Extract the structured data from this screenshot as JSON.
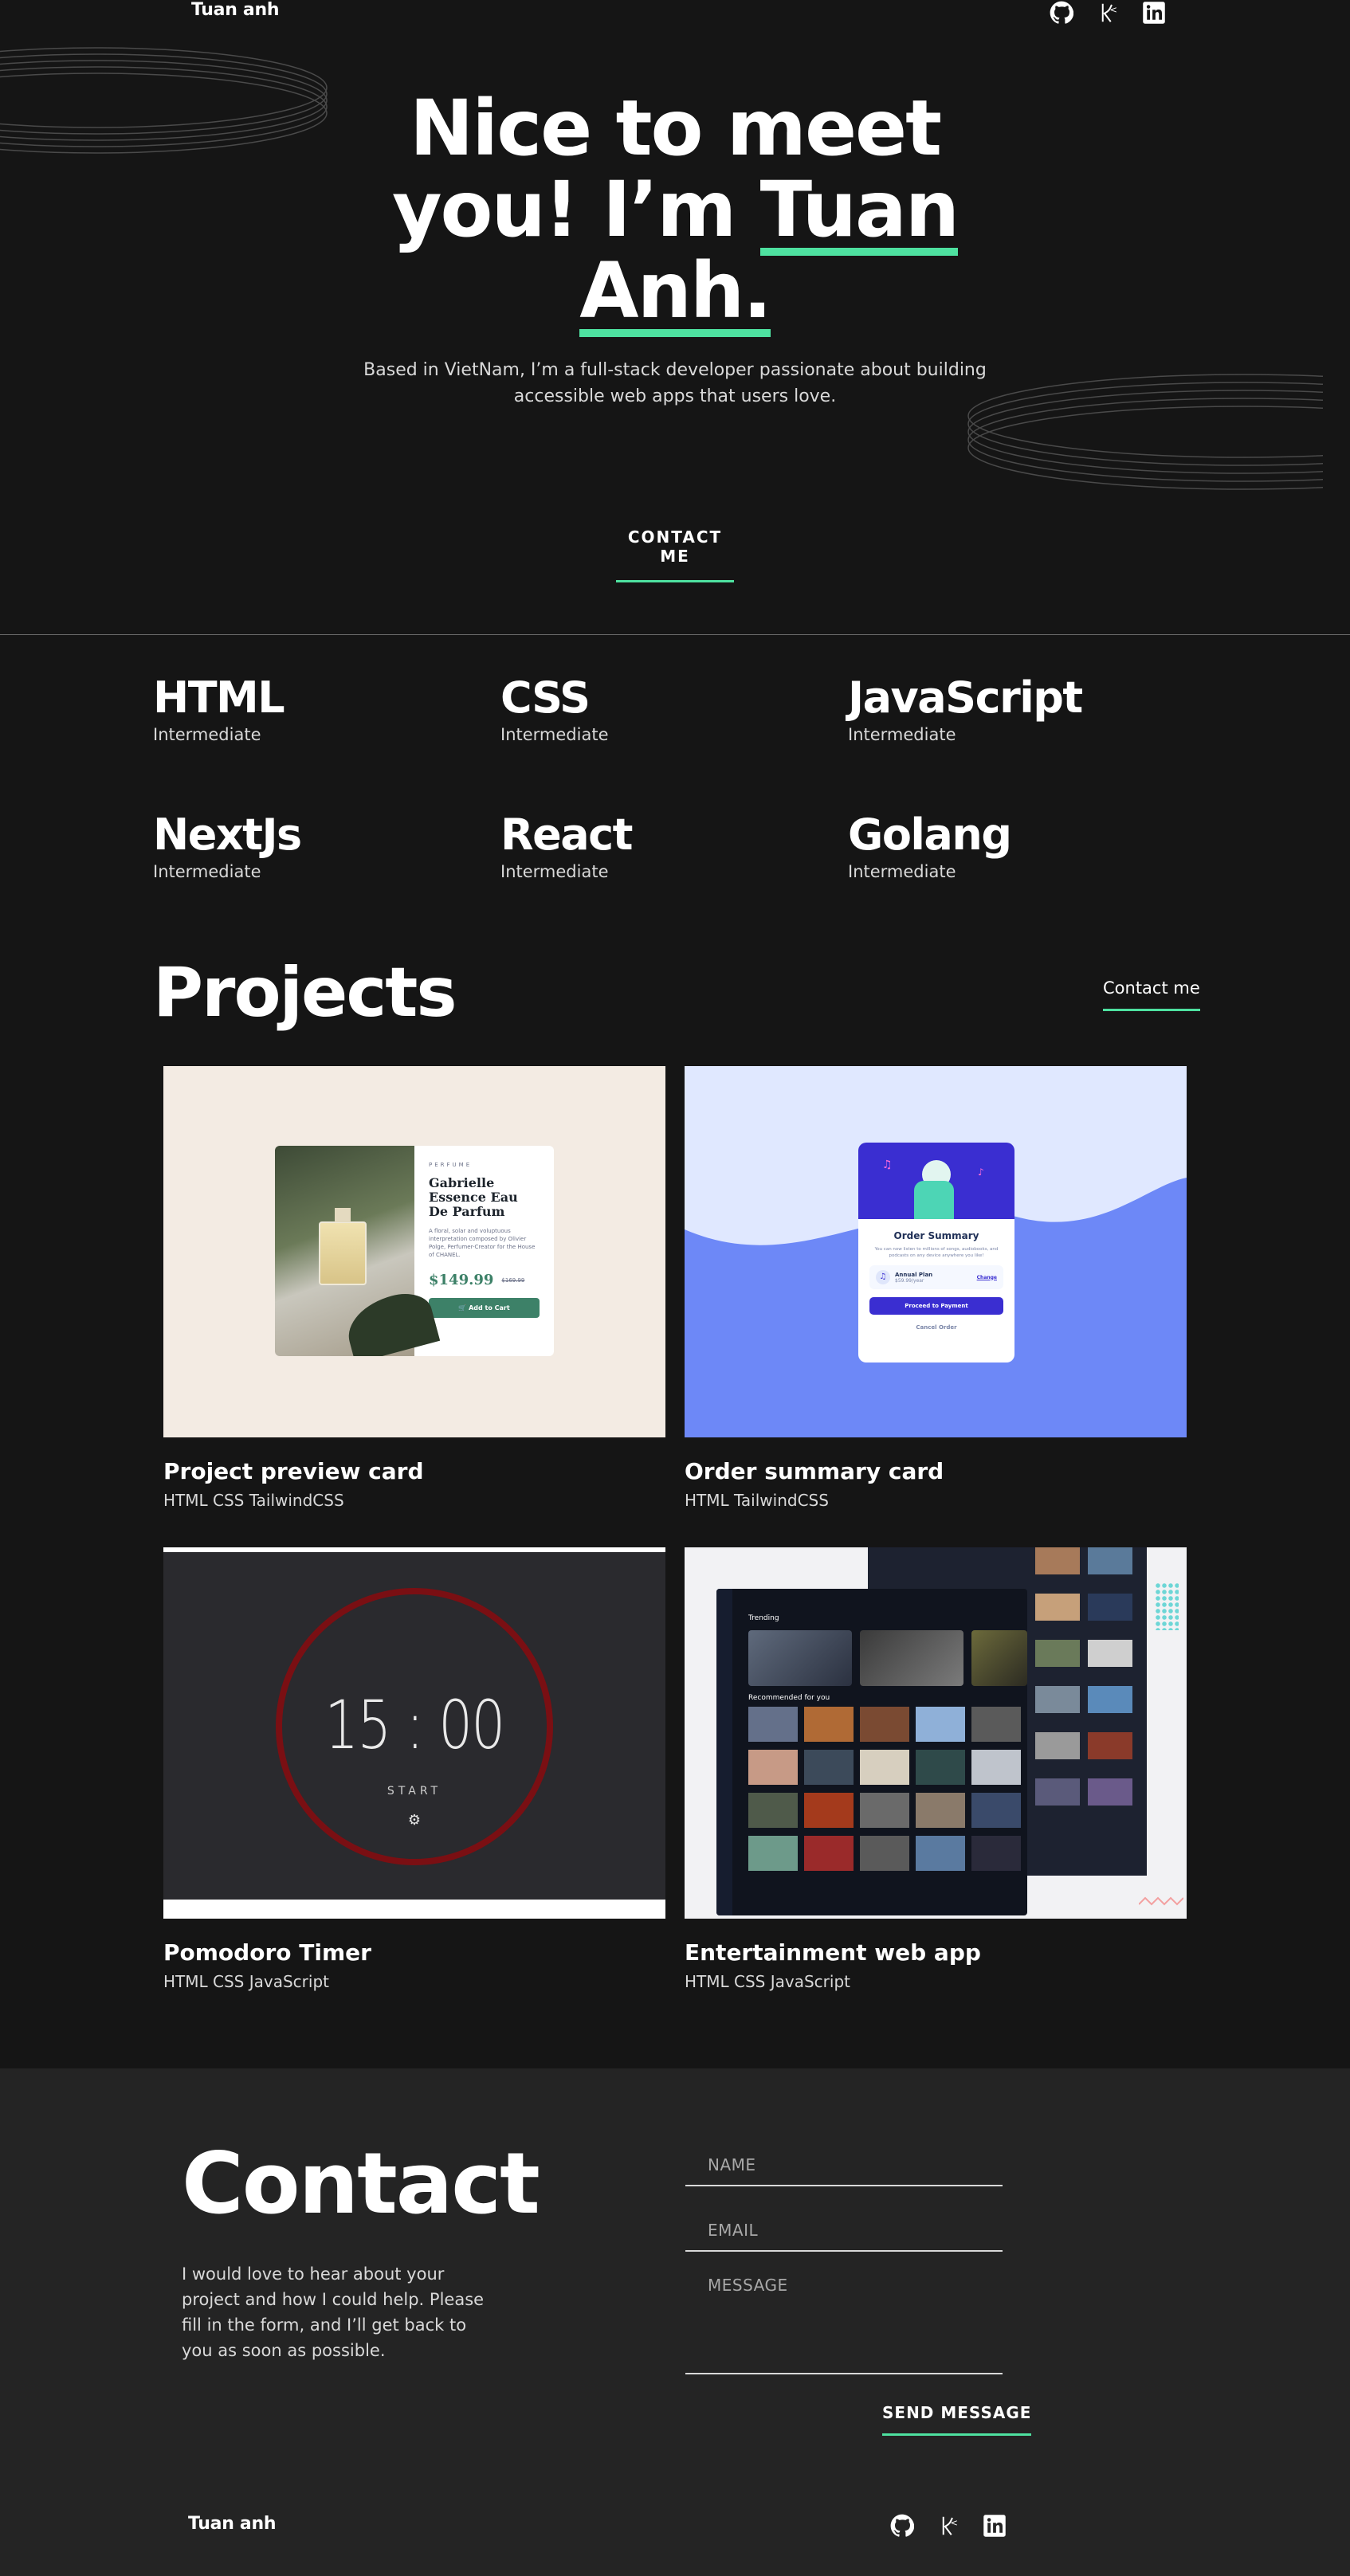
{
  "header": {
    "brand": "Tuan anh",
    "social": [
      {
        "icon": "github-icon",
        "label": "GitHub"
      },
      {
        "icon": "kaggle-icon",
        "label": "K"
      },
      {
        "icon": "linkedin-icon",
        "label": "in"
      }
    ]
  },
  "hero": {
    "title_line1": "Nice to meet",
    "title_line2_a": "you! I’m ",
    "title_line2_b": "Tuan",
    "title_line3": "Anh.",
    "subtitle_line1": "Based in VietNam, I’m a full-stack developer passionate about building",
    "subtitle_line2": "accessible web apps that users love.",
    "cta": "CONTACT ME"
  },
  "skills": [
    {
      "name": "HTML",
      "level": "Intermediate"
    },
    {
      "name": "CSS",
      "level": "Intermediate"
    },
    {
      "name": "JavaScript",
      "level": "Intermediate"
    },
    {
      "name": "NextJs",
      "level": "Intermediate"
    },
    {
      "name": "React",
      "level": "Intermediate"
    },
    {
      "name": "Golang",
      "level": "Intermediate"
    }
  ],
  "projects": {
    "title": "Projects",
    "contact_link": "Contact me",
    "items": [
      {
        "title": "Project preview card",
        "tags": "HTML CSS TailwindCSS",
        "preview": {
          "category": "PERFUME",
          "name": "Gabrielle Essence Eau De Parfum",
          "desc": "A floral, solar and voluptuous interpretation composed by Olivier Polge, Perfumer-Creator for the House of CHANEL.",
          "price": "$149.99",
          "old_price": "$169.99",
          "button": "Add to Cart"
        }
      },
      {
        "title": "Order summary card",
        "tags": "HTML TailwindCSS",
        "preview": {
          "heading": "Order Summary",
          "desc": "You can now listen to millions of songs, audiobooks, and podcasts on any device anywhere you like!",
          "plan": "Annual Plan",
          "plan_price": "$59.99/year",
          "change": "Change",
          "pay": "Proceed to Payment",
          "cancel": "Cancel Order"
        }
      },
      {
        "title": "Pomodoro Timer",
        "tags": "HTML CSS JavaScript",
        "preview": {
          "time": "15 : 00",
          "start": "START"
        }
      },
      {
        "title": "Entertainment web app",
        "tags": "HTML CSS JavaScript",
        "preview": {
          "trending": "Trending",
          "recommended": "Recommended for you"
        }
      }
    ]
  },
  "contact": {
    "title": "Contact",
    "text": "I would love to hear about your project and how I could help. Please fill in the form, and I’ll get back to you as soon as possible.",
    "name_placeholder": "NAME",
    "email_placeholder": "EMAIL",
    "message_placeholder": "MESSAGE",
    "send": "SEND MESSAGE"
  },
  "footer": {
    "brand": "Tuan anh"
  },
  "colors": {
    "accent": "#4ee1a0",
    "background": "#151515",
    "contact_background": "#242424"
  }
}
